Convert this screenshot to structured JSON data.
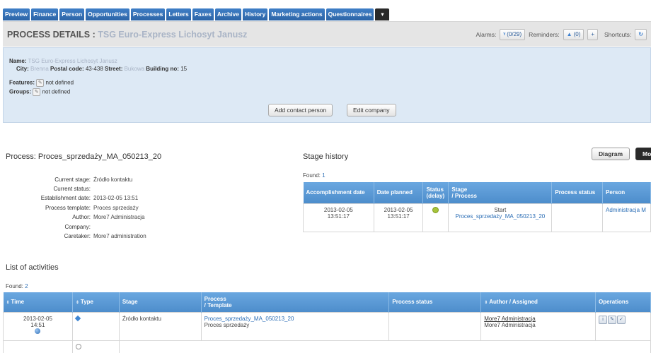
{
  "tabs": [
    "Preview",
    "Finance",
    "Person",
    "Opportunities",
    "Processes",
    "Letters",
    "Faxes",
    "Archive",
    "History",
    "Marketing actions",
    "Questionnaires"
  ],
  "tab_more_label": "▾",
  "header": {
    "title_prefix": "PROCESS DETAILS : ",
    "title_company": "TSG Euro-Express Lichosyt Janusz",
    "alarms_label": "Alarms:",
    "alarms_value": "(0/29)",
    "reminders_label": "Reminders:",
    "reminders_value": "(0)",
    "reminders_add": "+",
    "shortcuts_label": "Shortcuts:",
    "shortcuts_icon": "↻"
  },
  "company": {
    "name_label": "Name:",
    "name_value": "TSG Euro-Express Lichosyt Janusz",
    "city_label": "City:",
    "city_value": "Brenna",
    "postal_label": "Postal code:",
    "postal_value": "43-438",
    "street_label": "Street:",
    "street_value": "Bukowa",
    "building_label": "Building no:",
    "building_value": "15",
    "features_label": "Features:",
    "features_value": "not defined",
    "groups_label": "Groups:",
    "groups_value": "not defined",
    "add_contact_label": "Add contact person",
    "edit_company_label": "Edit company"
  },
  "process": {
    "title": "Process: Proces_sprzedaży_MA_050213_20",
    "fields": [
      {
        "k": "Current stage:",
        "v": "Źródło kontaktu"
      },
      {
        "k": "Current status:",
        "v": ""
      },
      {
        "k": "Establishment date:",
        "v": "2013-02-05 13:51"
      },
      {
        "k": "Process template:",
        "v": "Proces sprzedaży"
      },
      {
        "k": "Author:",
        "v": "More7 Administracja"
      },
      {
        "k": "Company:",
        "v": ""
      },
      {
        "k": "Caretaker:",
        "v": "More7 administration"
      }
    ]
  },
  "stage_history": {
    "title": "Stage history",
    "found_label": "Found:",
    "found_count": "1",
    "diagram_label": "Diagram",
    "more_label": "More",
    "headers": [
      "Accomplishment date",
      "Date planned",
      "Status\n(delay)",
      "Stage\n/ Process",
      "Process status",
      "Person"
    ],
    "row": {
      "accomplished": "2013-02-05\n13:51:17",
      "planned": "2013-02-05\n13:51:17",
      "stage": "Start",
      "process": "Proces_sprzedaży_MA_050213_20",
      "process_status": "",
      "person": "Administracja M"
    }
  },
  "activities": {
    "title": "List of activities",
    "found_label": "Found:",
    "found_count": "2",
    "headers": [
      "Time",
      "Type",
      "Stage",
      "Process\n/ Template",
      "Process status",
      "Author / Assigned",
      "Operations"
    ],
    "row": {
      "time": "2013-02-05\n14:51",
      "stage": "Źródło kontaktu",
      "process": "Proces_sprzedaży_MA_050213_20",
      "template": "Proces sprzedaży",
      "process_status": "",
      "author": "More7 Administracja",
      "assigned": "More7 Administracja"
    }
  },
  "colors": {
    "tab": "#2c64a6",
    "table_header": "#5b9bd5",
    "panel": "#dde9f5",
    "link": "#2a6db5"
  }
}
